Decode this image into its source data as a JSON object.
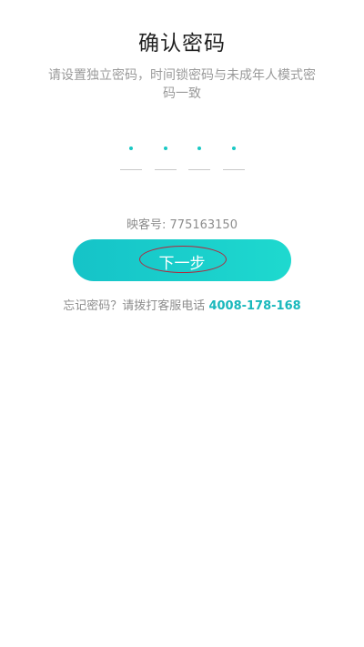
{
  "header": {
    "title": "确认密码",
    "subtitle": "请设置独立密码，时间锁密码与未成年人模式密码一致"
  },
  "pin": {
    "digits": [
      "•",
      "•",
      "•",
      "•"
    ],
    "length": 4
  },
  "account": {
    "text": "映客号: 775163150"
  },
  "actions": {
    "next_label": "下一步"
  },
  "help": {
    "text": "忘记密码？请拨打客服电话 ",
    "phone": "4008-178-168"
  },
  "colors": {
    "accent": "#19c8c4",
    "button_gradient_start": "#15c3c8",
    "button_gradient_end": "#1ed9cf",
    "annotation": "#b3263c"
  }
}
